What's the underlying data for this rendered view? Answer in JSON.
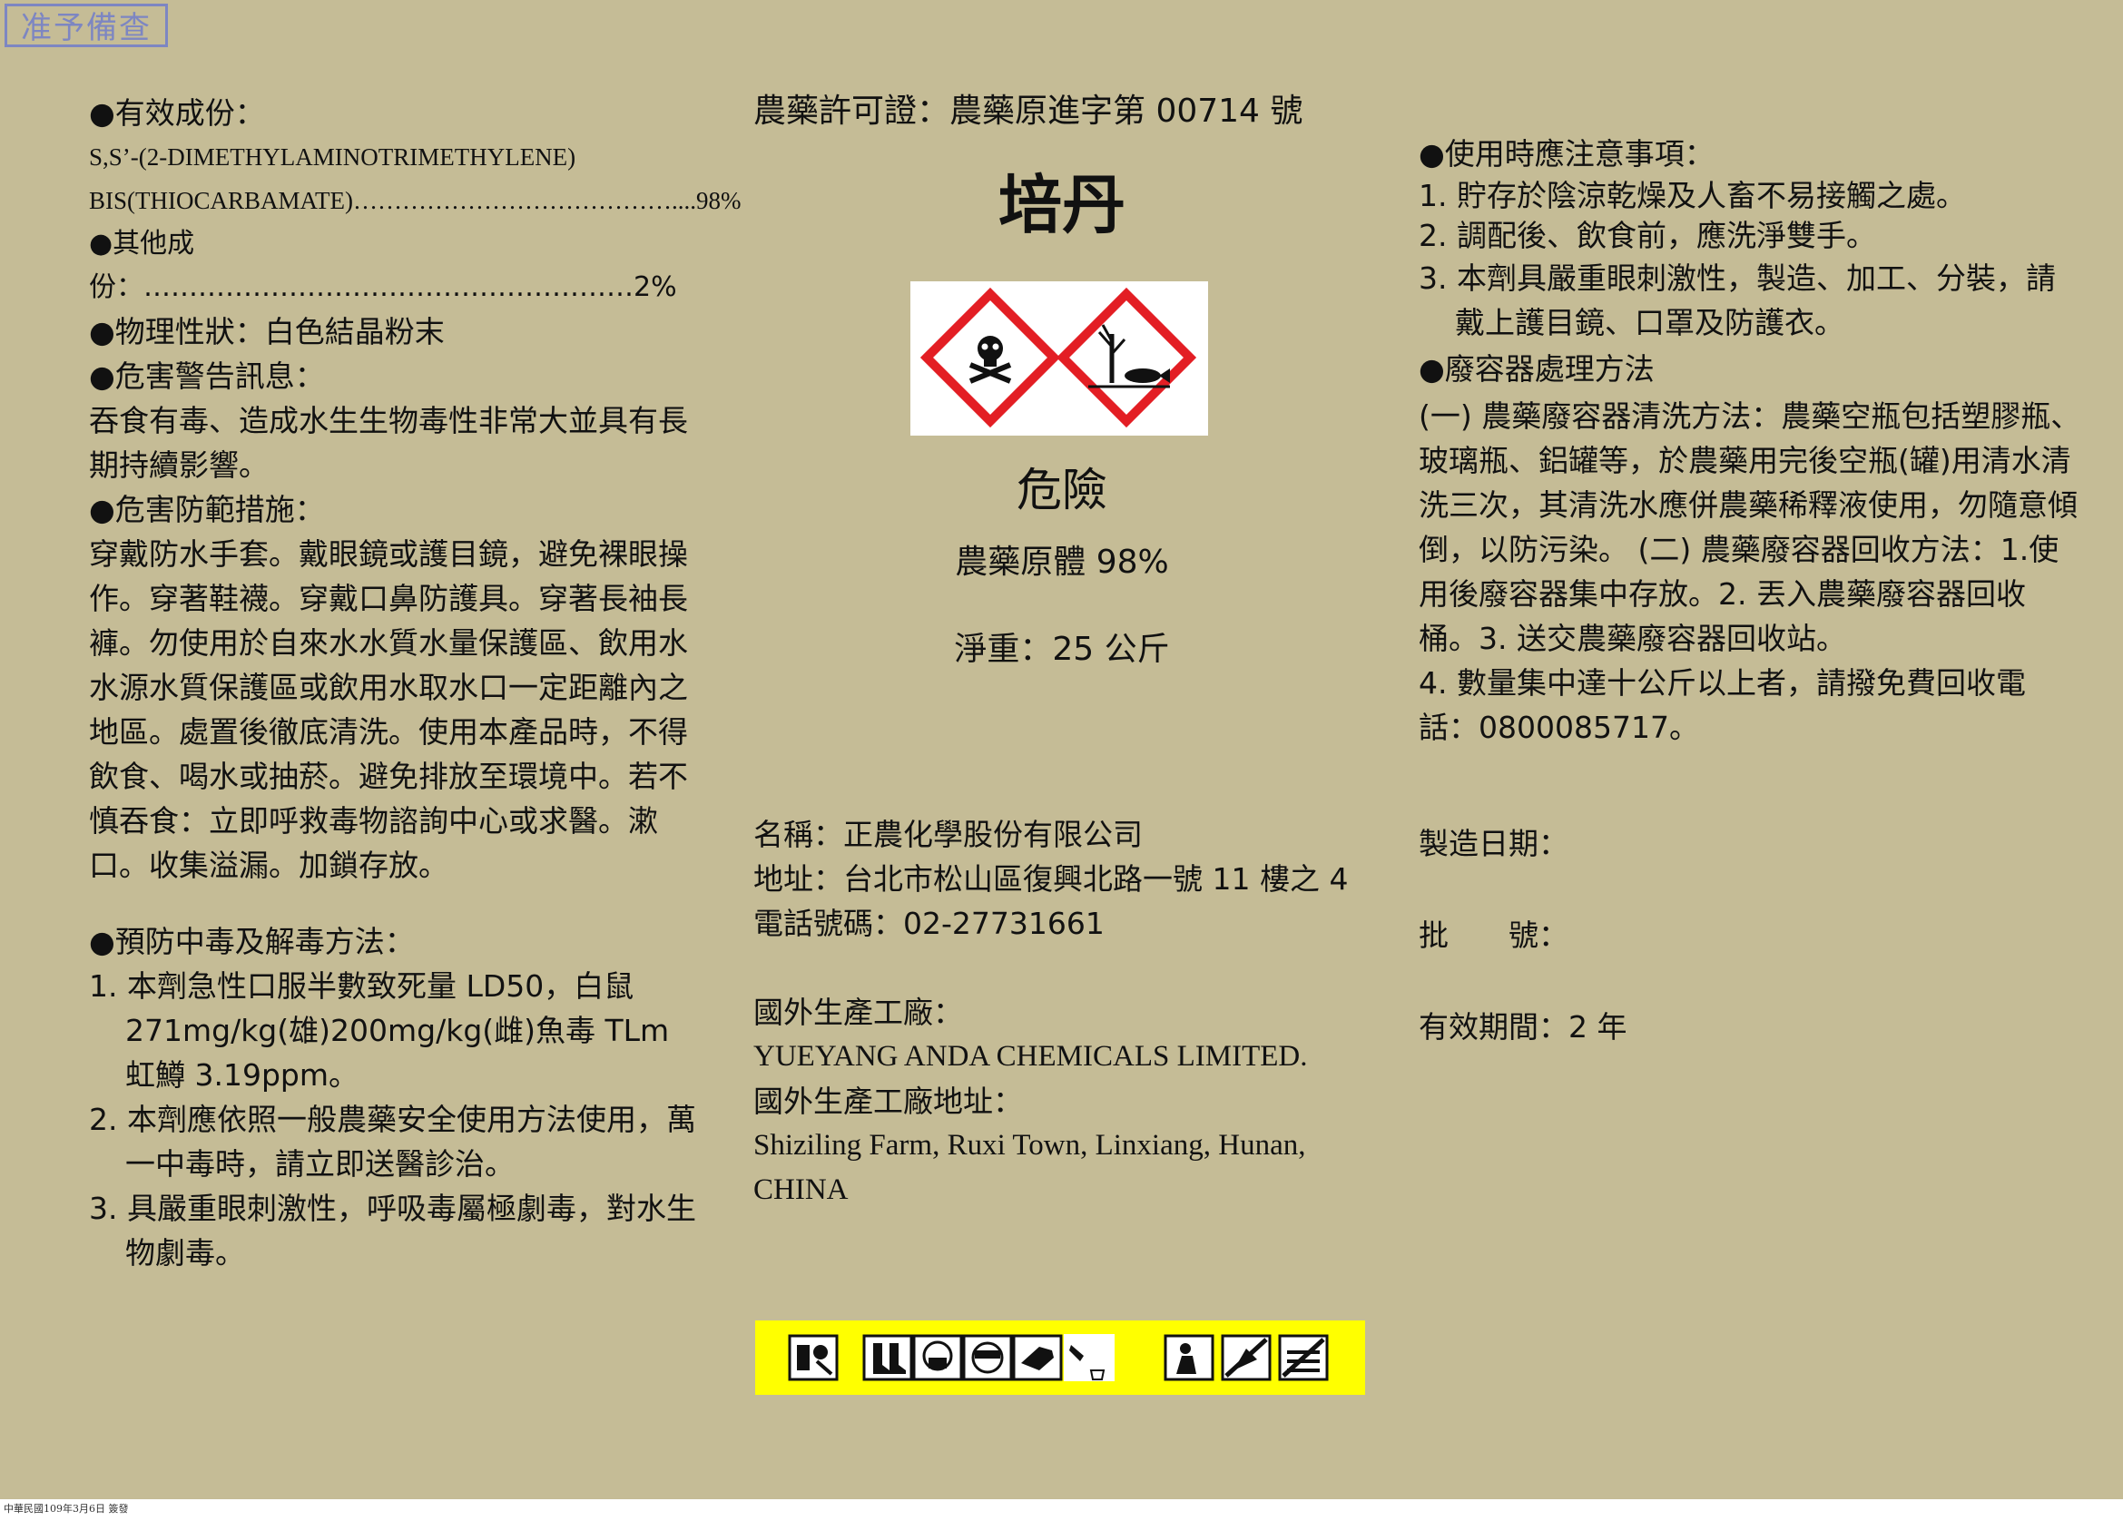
{
  "stamp": "准予備查",
  "footer": "中華民國109年3月6日 簽發",
  "left": {
    "ingredients_heading": "●有效成份：",
    "ingredient_line1": "S,S’-(2-DIMETHYLAMINOTRIMETHYLENE)",
    "ingredient_line2": "BIS(THIOCARBAMATE)…………………………………....98%",
    "other": "●其他成份：………………………………………………2%",
    "physical": "●物理性狀：白色結晶粉末",
    "hazard_heading": "●危害警告訊息：",
    "hazard_text": "吞食有毒、造成水生生物毒性非常大並具有長期持續影響。",
    "prevention_heading": "●危害防範措施：",
    "prevention_text": "穿戴防水手套。戴眼鏡或護目鏡，避免裸眼操作。穿著鞋襪。穿戴口鼻防護具。穿著長袖長褲。勿使用於自來水水質水量保護區、飲用水水源水質保護區或飲用水取水口一定距離內之地區。處置後徹底清洗。使用本產品時，不得飲食、喝水或抽菸。避免排放至環境中。若不慎吞食：立即呼救毒物諮詢中心或求醫。漱口。收集溢漏。加鎖存放。",
    "antidote_heading": "●預防中毒及解毒方法：",
    "antidote_items": [
      "1.  本劑急性口服半數致死量 LD50，白鼠 271mg/kg(雄)200mg/kg(雌)魚毒 TLm 虹鱒 3.19ppm。",
      "2.  本劑應依照一般農藥安全使用方法使用，萬一中毒時，請立即送醫診治。",
      "3.  具嚴重眼刺激性，呼吸毒屬極劇毒，對水生物劇毒。"
    ]
  },
  "middle": {
    "permit": "農藥許可證：農藥原進字第 00714 號",
    "product_name": "培丹",
    "signal_word": "危險",
    "grade": "農藥原體 98%",
    "net_weight": "淨重：25 公斤",
    "company": "名稱：正農化學股份有限公司",
    "address": "地址：台北市松山區復興北路一號 11 樓之 4",
    "phone": "電話號碼：02-27731661",
    "factory_label": "國外生產工廠：",
    "factory_name": "YUEYANG ANDA CHEMICALS LIMITED.",
    "factory_address_label": "國外生產工廠地址：",
    "factory_address": "Shiziling Farm, Ruxi Town, Linxiang, Hunan, CHINA"
  },
  "right": {
    "precautions_heading": "●使用時應注意事項：",
    "precautions": [
      "1.  貯存於陰涼乾燥及人畜不易接觸之處。",
      "2.  調配後、飲食前，應洗淨雙手。",
      "3.  本劑具嚴重眼刺激性，製造、加工、分裝，請戴上護目鏡、口罩及防護衣。"
    ],
    "disposal_heading": "●廢容器處理方法",
    "disposal_text": "(一) 農藥廢容器清洗方法：農藥空瓶包括塑膠瓶、玻璃瓶、鋁罐等，於農藥用完後空瓶(罐)用清水清洗三次，其清洗水應併農藥稀釋液使用，勿隨意傾倒，以防污染。 (二) 農藥廢容器回收方法：1.使用後廢容器集中存放。2. 丟入農藥廢容器回收桶。3. 送交農藥廢容器回收站。",
    "disposal_item4": "4. 數量集中達十公斤以上者，請撥免費回收電話：0800085717。",
    "manufacture_date": "製造日期：",
    "batch_no": "批　　號：",
    "validity": "有效期間：2 年"
  },
  "icons": {
    "ghs": [
      "skull-crossbones-icon",
      "environment-hazard-icon"
    ],
    "pictograms": [
      "mixing-icon",
      "boots-icon",
      "mask-icon",
      "goggles-icon",
      "gloves-icon",
      "spray-icon",
      "wash-icon",
      "no-eating-icon",
      "no-animals-icon"
    ]
  },
  "colors": {
    "background": "#c5bc96",
    "ghs_red": "#e31e24",
    "pictogram_bar": "#ffff00",
    "stamp": "#7d86c2"
  }
}
